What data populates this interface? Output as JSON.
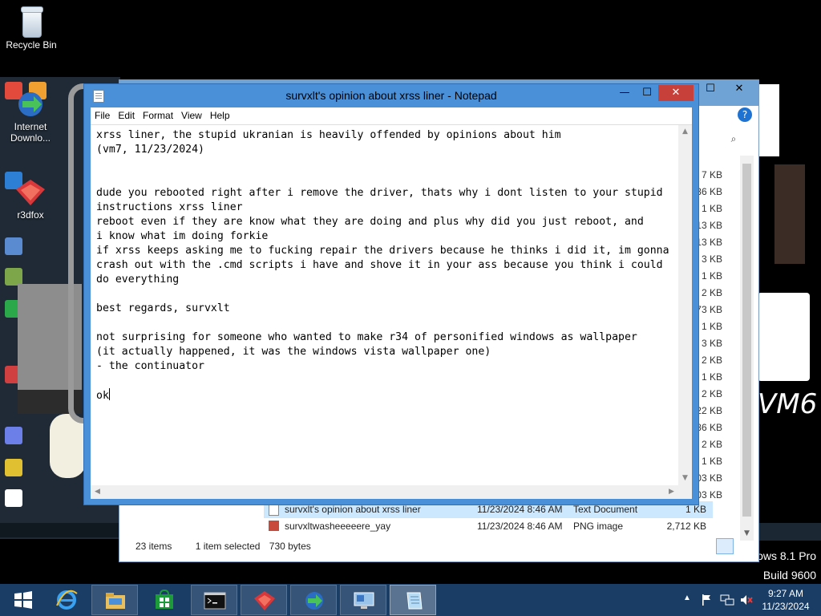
{
  "desktop": {
    "recycle_bin_label": "Recycle Bin",
    "overlay_icons": [
      {
        "label_line1": "Internet",
        "label_line2": "Downlo..."
      },
      {
        "label_line1": "r3dfox",
        "label_line2": ""
      }
    ],
    "wallpaper_text": "VM6",
    "windows_version_line1": "ows 8.1 Pro",
    "windows_version_line2": "Build 9600"
  },
  "explorer": {
    "status_items": "23 items",
    "status_selected": "1 item selected",
    "status_size": "730 bytes",
    "size_column": [
      "7 KB",
      "36 KB",
      "1 KB",
      "13 KB",
      "13 KB",
      "3 KB",
      "1 KB",
      "2 KB",
      "73 KB",
      "1 KB",
      "3 KB",
      "2 KB",
      "1 KB",
      "2 KB",
      "22 KB",
      "86 KB",
      "2 KB",
      "1 KB",
      "03 KB",
      "03 KB"
    ],
    "rows": [
      {
        "name": "survxlt's opinion about xrss liner",
        "date": "11/23/2024 8:46 AM",
        "type": "Text Document",
        "size": "1 KB",
        "selected": true
      },
      {
        "name": "survxltwasheeeeere_yay",
        "date": "11/23/2024 8:46 AM",
        "type": "PNG image",
        "size": "2,712 KB",
        "selected": false
      }
    ]
  },
  "notepad": {
    "title": "survxlt's opinion about xrss liner - Notepad",
    "menu": [
      "File",
      "Edit",
      "Format",
      "View",
      "Help"
    ],
    "minimize_glyph": "—",
    "maximize_glyph": "☐",
    "close_glyph": "✕",
    "content": "xrss liner, the stupid ukranian is heavily offended by opinions about him\n(vm7, 11/23/2024)\n\n\ndude you rebooted right after i remove the driver, thats why i dont listen to your stupid\ninstructions xrss liner\nreboot even if they are know what they are doing and plus why did you just reboot, and\ni know what im doing forkie\nif xrss keeps asking me to fucking repair the drivers because he thinks i did it, im gonna\ncrash out with the .cmd scripts i have and shove it in your ass because you think i could\ndo everything\n\nbest regards, survxlt\n\nnot surprising for someone who wanted to make r34 of personified windows as wallpaper\n(it actually happened, it was the windows vista wallpaper one)\n- the continuator\n\nok"
  },
  "taskbar": {
    "apps": [
      "start",
      "internet-explorer",
      "file-explorer",
      "store",
      "command-prompt",
      "r3dfox",
      "internet-download-manager",
      "remote-desktop",
      "notepad"
    ],
    "clock_time": "9:27 AM",
    "clock_date": "11/23/2024"
  },
  "colors": {
    "taskbar": "#1a3d66",
    "notepad_frame": "#4a90d8",
    "close_button": "#c7403a"
  }
}
